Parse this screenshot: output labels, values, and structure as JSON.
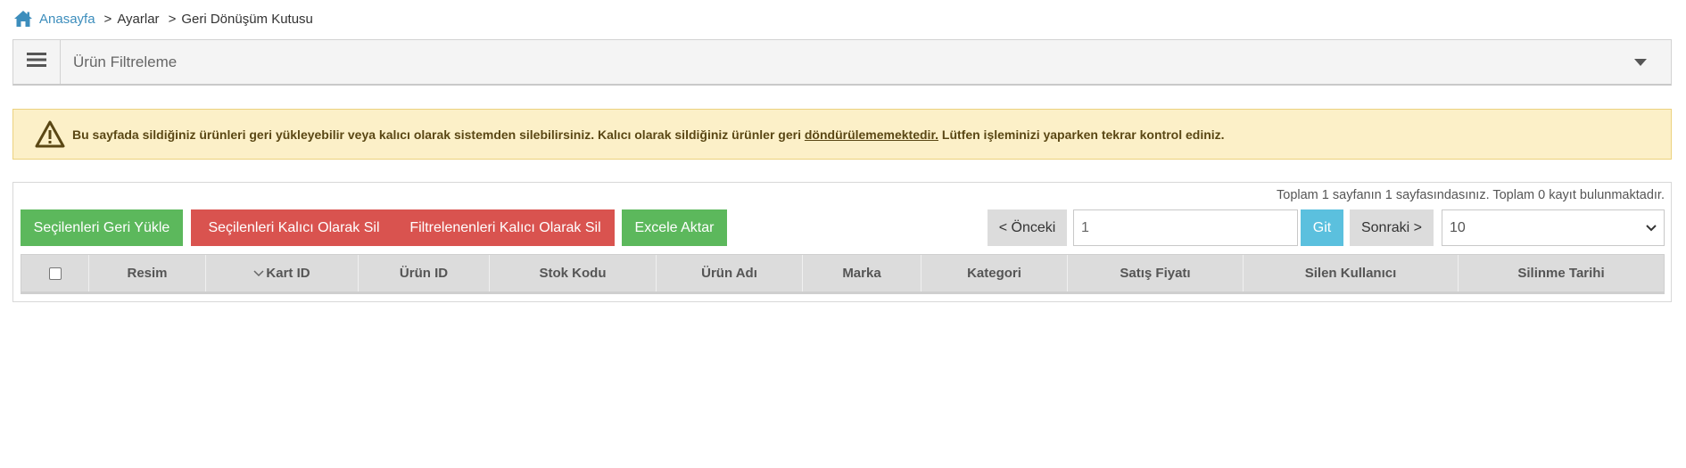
{
  "breadcrumb": {
    "home": "Anasayfa",
    "separator": ">",
    "items": [
      "Ayarlar",
      "Geri Dönüşüm Kutusu"
    ]
  },
  "filter": {
    "title": "Ürün Filtreleme"
  },
  "alert": {
    "text_before": "Bu sayfada sildiğiniz ürünleri geri yükleyebilir veya kalıcı olarak sistemden silebilirsiniz. Kalıcı olarak sildiğiniz ürünler geri ",
    "underlined": "döndürülememektedir.",
    "text_after": " Lütfen işleminizi yaparken tekrar kontrol ediniz."
  },
  "paging": {
    "info": "Toplam 1 sayfanın 1 sayfasındasınız. Toplam 0 kayıt bulunmaktadır.",
    "prev": "< Önceki",
    "page_value": "1",
    "go": "Git",
    "next": "Sonraki >",
    "page_size": "10"
  },
  "actions": {
    "restore_selected": "Seçilenleri Geri Yükle",
    "delete_selected": "Seçilenleri Kalıcı Olarak Sil",
    "delete_filtered": "Filtrelenenleri Kalıcı Olarak Sil",
    "export_excel": "Excele Aktar"
  },
  "table": {
    "columns": [
      "Resim",
      "Kart ID",
      "Ürün ID",
      "Stok Kodu",
      "Ürün Adı",
      "Marka",
      "Kategori",
      "Satış Fiyatı",
      "Silen Kullanıcı",
      "Silinme Tarihi"
    ]
  },
  "colors": {
    "link": "#3c8dbc",
    "success": "#5cb85c",
    "danger": "#d9534f",
    "info": "#5bc0de",
    "warning_bg": "#fcf0c8"
  },
  "icons": [
    "home-icon",
    "menu-icon",
    "caret-down-icon",
    "warning-icon",
    "sort-icon",
    "chevron-down-icon"
  ]
}
